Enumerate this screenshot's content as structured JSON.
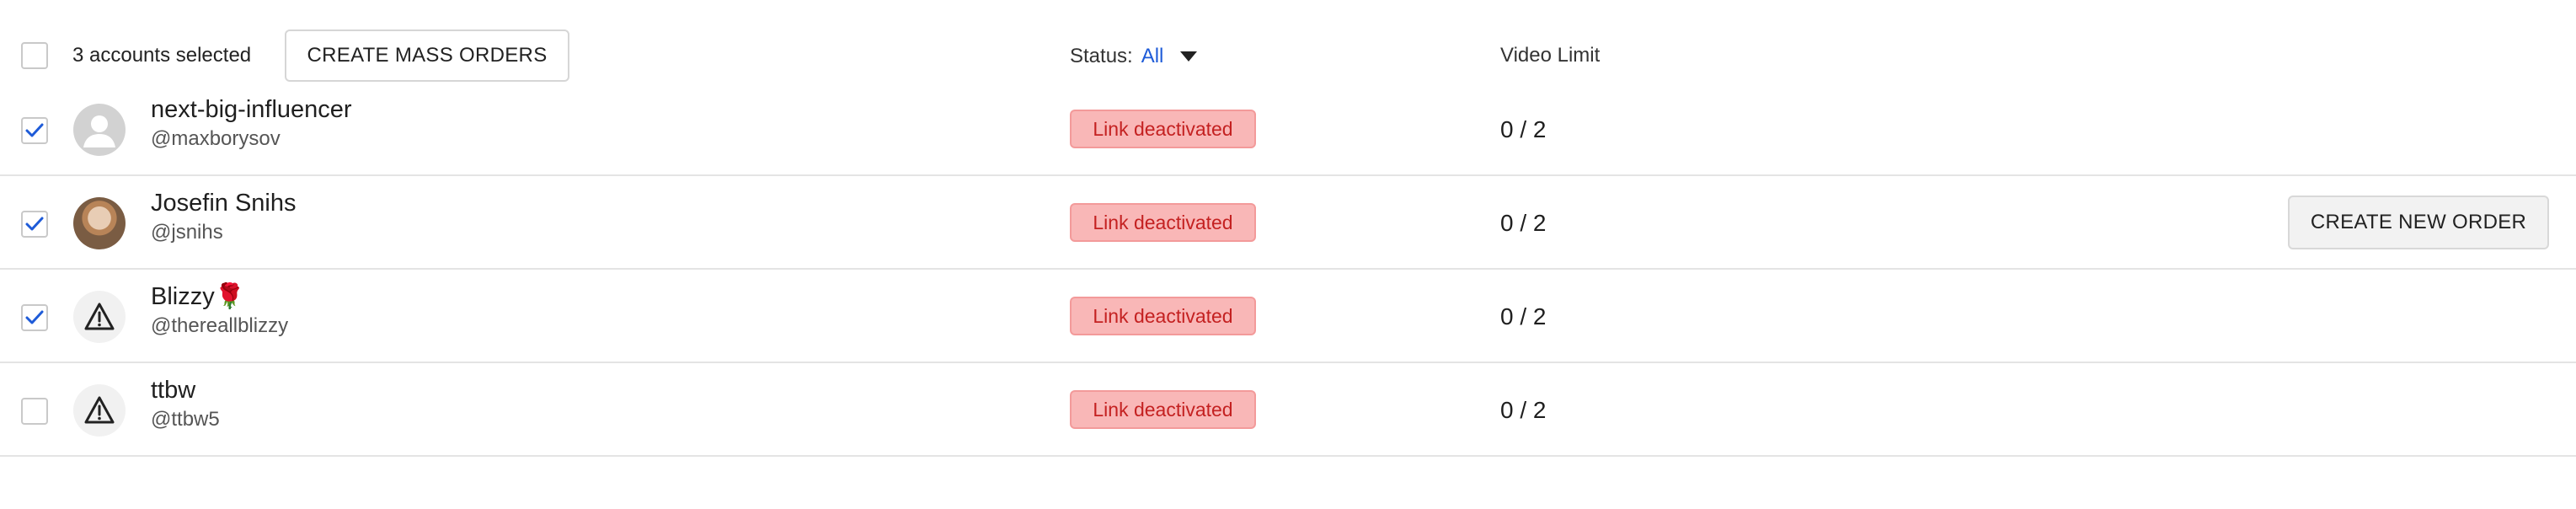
{
  "header": {
    "selected_text": "3 accounts selected",
    "mass_orders_label": "CREATE MASS ORDERS",
    "status_label": "Status:",
    "status_value": "All",
    "video_limit_label": "Video Limit"
  },
  "rows": [
    {
      "checked": true,
      "avatar": "placeholder-person-icon",
      "name": "next-big-influencer",
      "handle": "@maxborysov",
      "status": "Link deactivated",
      "video_limit": "0 / 2"
    },
    {
      "checked": true,
      "avatar": "profile-photo",
      "name": "Josefin Snihs",
      "handle": "@jsnihs",
      "status": "Link deactivated",
      "video_limit": "0 / 2",
      "action_label": "CREATE NEW ORDER"
    },
    {
      "checked": true,
      "avatar": "warning-icon",
      "name": "Blizzy🌹",
      "handle": "@thereallblizzy",
      "status": "Link deactivated",
      "video_limit": "0 / 2"
    },
    {
      "checked": false,
      "avatar": "warning-icon",
      "name": "ttbw",
      "handle": "@ttbw5",
      "status": "Link deactivated",
      "video_limit": "0 / 2"
    }
  ],
  "colors": {
    "accent": "#1e5bd8",
    "badge_bg": "#f9b7b7",
    "badge_text": "#c42121"
  }
}
